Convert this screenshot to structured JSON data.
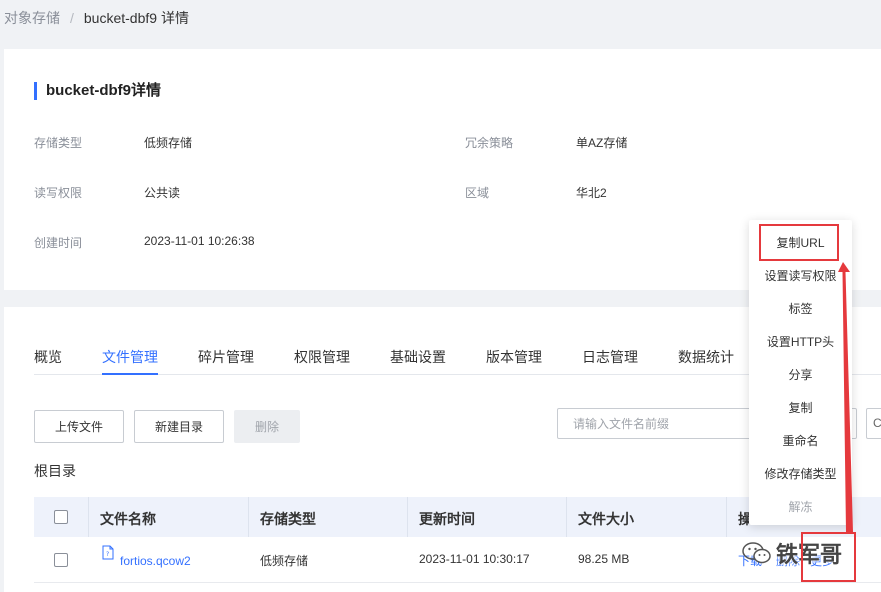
{
  "breadcrumb": {
    "root": "对象存储",
    "separator": "/",
    "current": "bucket-dbf9 详情"
  },
  "info": {
    "title": "bucket-dbf9详情",
    "fields": [
      {
        "label": "存储类型",
        "value": "低频存储"
      },
      {
        "label": "冗余策略",
        "value": "单AZ存储"
      },
      {
        "label": "读写权限",
        "value": "公共读"
      },
      {
        "label": "区域",
        "value": "华北2"
      },
      {
        "label": "创建时间",
        "value": "2023-11-01 10:26:38"
      }
    ]
  },
  "tabs": [
    {
      "label": "概览"
    },
    {
      "label": "文件管理",
      "active": true
    },
    {
      "label": "碎片管理"
    },
    {
      "label": "权限管理"
    },
    {
      "label": "基础设置"
    },
    {
      "label": "版本管理"
    },
    {
      "label": "日志管理"
    },
    {
      "label": "数据统计"
    }
  ],
  "toolbar": {
    "upload_label": "上传文件",
    "new_folder_label": "新建目录",
    "delete_label": "删除",
    "search_placeholder": "请输入文件名前缀",
    "extra_label": "C"
  },
  "root_label": "根目录",
  "table": {
    "headers": [
      "文件名称",
      "存储类型",
      "更新时间",
      "文件大小",
      "操"
    ],
    "rows": [
      {
        "name": "fortios.qcow2",
        "storage": "低频存储",
        "updated": "2023-11-01 10:30:17",
        "size": "98.25 MB",
        "actions": {
          "download": "下载",
          "delete": "删除",
          "more": "更多"
        }
      }
    ]
  },
  "more_menu": {
    "items": [
      {
        "label": "复制URL"
      },
      {
        "label": "设置读写权限"
      },
      {
        "label": "标签"
      },
      {
        "label": "设置HTTP头"
      },
      {
        "label": "分享"
      },
      {
        "label": "复制"
      },
      {
        "label": "重命名"
      },
      {
        "label": "修改存储类型"
      },
      {
        "label": "解冻",
        "disabled": true
      }
    ]
  },
  "watermark": {
    "text": "铁军哥"
  },
  "colors": {
    "accent": "#3370ff",
    "highlight": "#e5393d",
    "header_bg": "#eef2fb"
  }
}
